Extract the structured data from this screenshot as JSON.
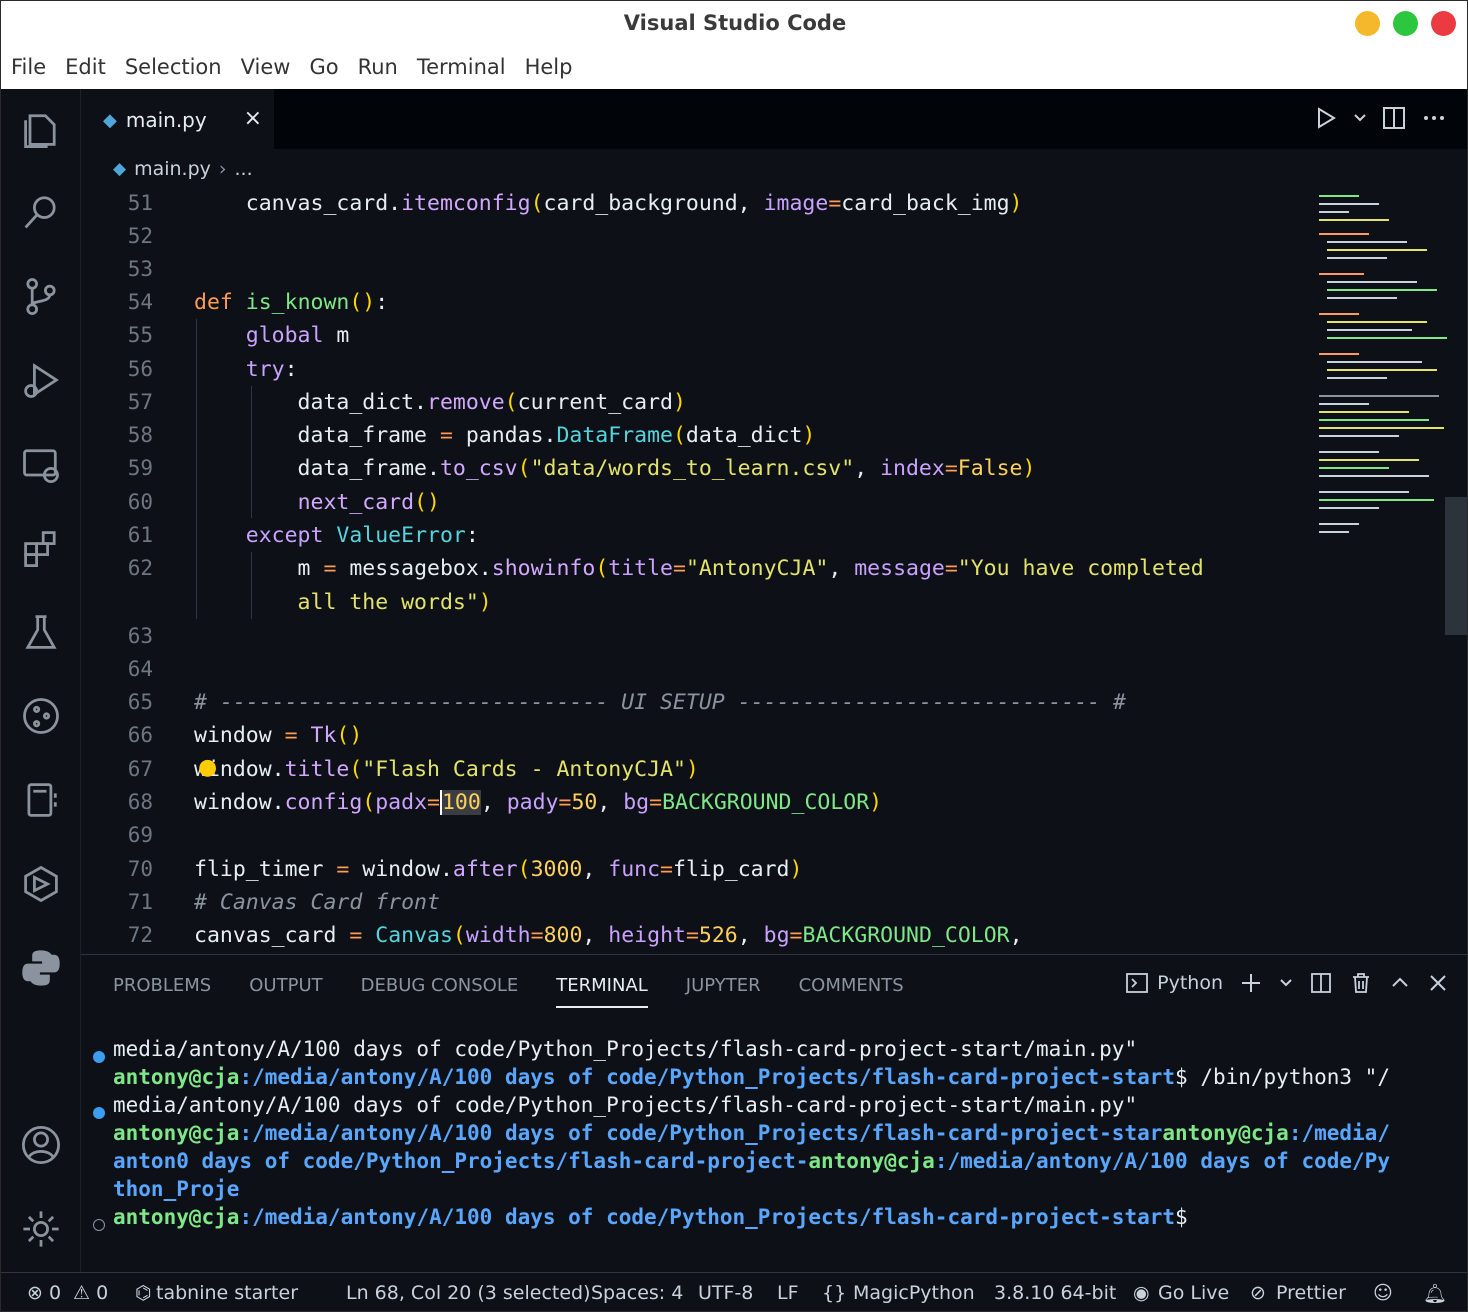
{
  "window": {
    "title": "Visual Studio Code"
  },
  "menu": [
    "File",
    "Edit",
    "Selection",
    "View",
    "Go",
    "Run",
    "Terminal",
    "Help"
  ],
  "tab": {
    "name": "main.py",
    "close": "×"
  },
  "breadcrumb": {
    "file": "main.py",
    "sep": "›",
    "more": "..."
  },
  "line_numbers": [
    "51",
    "52",
    "53",
    "54",
    "55",
    "56",
    "57",
    "58",
    "59",
    "60",
    "61",
    "62",
    "63",
    "64",
    "65",
    "66",
    "67",
    "68",
    "69",
    "70",
    "71",
    "72"
  ],
  "panel": {
    "tabs": [
      "PROBLEMS",
      "OUTPUT",
      "DEBUG CONSOLE",
      "TERMINAL",
      "JUPYTER",
      "COMMENTS"
    ],
    "shell": "Python"
  },
  "terminal": {
    "l1": "media/antony/A/100 days of code/Python_Projects/flash-card-project-start/main.py\"",
    "l2_user": "antony@cja",
    "l2_path": ":/media/antony/A/100 days of code/Python_Projects/flash-card-project-start",
    "l2_cmd": "$ /bin/python3 \"/",
    "l3": "media/antony/A/100 days of code/Python_Projects/flash-card-project-start/main.py\"",
    "l4_user": "antony@cja",
    "l4_path": ":/media/antony/A/100 days of code/Python_Projects/flash-card-project-star",
    "l4_user2": "antony@cja",
    "l4_path2": ":/media/",
    "l5_path": "anton0 days of code/Python_Projects/flash-card-project-",
    "l5_user": "antony@cja",
    "l5_path2": ":/media/antony/A/100 days of code/Py",
    "l6": "thon_Proje",
    "l7_user": "antony@cja",
    "l7_path": ":/media/antony/A/100 days of code/Python_Projects/flash-card-project-start",
    "l7_end": "$"
  },
  "status": {
    "errors": "⊗ 0",
    "warnings": "⚠ 0",
    "tabnine": "tabnine starter",
    "position": "Ln 68, Col 20 (3 selected)",
    "spaces": "Spaces: 4",
    "encoding": "UTF-8",
    "eol": "LF",
    "language": "MagicPython",
    "interpreter": "3.8.10 64-bit",
    "golive": "Go Live",
    "prettier": "Prettier"
  }
}
